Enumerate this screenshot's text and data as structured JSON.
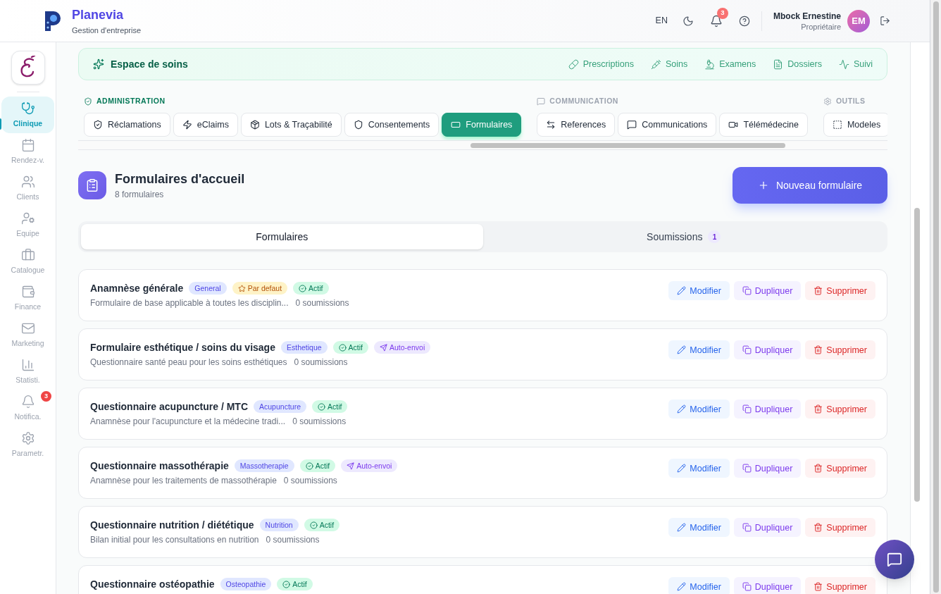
{
  "header": {
    "brand": "Planevia",
    "tagline": "Gestion d'entreprise",
    "language": "EN",
    "notification_count": "3",
    "user": {
      "name": "Mbock Ernestine",
      "role": "Propriétaire",
      "initials": "EM"
    }
  },
  "sidebar": {
    "items": [
      {
        "label": "Clinique",
        "selected": true
      },
      {
        "label": "Rendez-v.",
        "selected": false
      },
      {
        "label": "Clients",
        "selected": false
      },
      {
        "label": "Equipe",
        "selected": false
      },
      {
        "label": "Catalogue",
        "selected": false
      },
      {
        "label": "Finance",
        "selected": false
      },
      {
        "label": "Marketing",
        "selected": false
      },
      {
        "label": "Statisti.",
        "selected": false
      },
      {
        "label": "Notifica.",
        "selected": false,
        "badge": "3"
      },
      {
        "label": "Parametr.",
        "selected": false
      }
    ]
  },
  "care_space": {
    "title": "Espace de soins",
    "links": [
      "Prescriptions",
      "Soins",
      "Examens",
      "Dossiers",
      "Suivi"
    ]
  },
  "tab_groups": [
    {
      "title": "ADMINISTRATION",
      "tabs": [
        {
          "label": "Réclamations",
          "selected": false
        },
        {
          "label": "eClaims",
          "selected": false
        },
        {
          "label": "Lots & Traçabilité",
          "selected": false
        },
        {
          "label": "Consentements",
          "selected": false
        },
        {
          "label": "Formulaires",
          "selected": true
        }
      ]
    },
    {
      "title": "COMMUNICATION",
      "tabs": [
        {
          "label": "References",
          "selected": false
        },
        {
          "label": "Communications",
          "selected": false
        },
        {
          "label": "Télémédecine",
          "selected": false
        }
      ]
    },
    {
      "title": "OUTILS",
      "tabs": [
        {
          "label": "Modeles",
          "selected": false
        }
      ]
    }
  ],
  "page": {
    "title": "Formulaires d'accueil",
    "subtitle": "8 formulaires",
    "new_button": "Nouveau formulaire"
  },
  "view_tabs": [
    {
      "label": "Formulaires",
      "selected": true
    },
    {
      "label": "Soumissions",
      "selected": false,
      "count": "1"
    }
  ],
  "forms": [
    {
      "title": "Anamnèse générale",
      "badges": [
        {
          "kind": "category",
          "label": "General"
        },
        {
          "kind": "default",
          "label": "Par defaut"
        },
        {
          "kind": "active",
          "label": "Actif"
        }
      ],
      "description": "Formulaire de base applicable à toutes les disciplin...",
      "submissions": "0 soumissions",
      "actions": [
        {
          "kind": "edit",
          "label": "Modifier"
        },
        {
          "kind": "duplicate",
          "label": "Dupliquer"
        },
        {
          "kind": "delete",
          "label": "Supprimer"
        }
      ]
    },
    {
      "title": "Formulaire esthétique / soins du visage",
      "badges": [
        {
          "kind": "category",
          "label": "Esthetique"
        },
        {
          "kind": "active",
          "label": "Actif"
        },
        {
          "kind": "auto_send",
          "label": "Auto-envoi"
        }
      ],
      "description": "Questionnaire santé peau pour les soins esthétiques",
      "submissions": "0 soumissions",
      "actions": [
        {
          "kind": "edit",
          "label": "Modifier"
        },
        {
          "kind": "duplicate",
          "label": "Dupliquer"
        },
        {
          "kind": "delete",
          "label": "Supprimer"
        }
      ]
    },
    {
      "title": "Questionnaire acupuncture / MTC",
      "badges": [
        {
          "kind": "category",
          "label": "Acupuncture"
        },
        {
          "kind": "active",
          "label": "Actif"
        }
      ],
      "description": "Anamnèse pour l'acupuncture et la médecine tradi...",
      "submissions": "0 soumissions",
      "actions": [
        {
          "kind": "edit",
          "label": "Modifier"
        },
        {
          "kind": "duplicate",
          "label": "Dupliquer"
        },
        {
          "kind": "delete",
          "label": "Supprimer"
        }
      ]
    },
    {
      "title": "Questionnaire massothérapie",
      "badges": [
        {
          "kind": "category",
          "label": "Massotherapie"
        },
        {
          "kind": "active",
          "label": "Actif"
        },
        {
          "kind": "auto_send",
          "label": "Auto-envoi"
        }
      ],
      "description": "Anamnèse pour les traitements de massothérapie",
      "submissions": "0 soumissions",
      "actions": [
        {
          "kind": "edit",
          "label": "Modifier"
        },
        {
          "kind": "duplicate",
          "label": "Dupliquer"
        },
        {
          "kind": "delete",
          "label": "Supprimer"
        }
      ]
    },
    {
      "title": "Questionnaire nutrition / diététique",
      "badges": [
        {
          "kind": "category",
          "label": "Nutrition"
        },
        {
          "kind": "active",
          "label": "Actif"
        }
      ],
      "description": "Bilan initial pour les consultations en nutrition",
      "submissions": "0 soumissions",
      "actions": [
        {
          "kind": "edit",
          "label": "Modifier"
        },
        {
          "kind": "duplicate",
          "label": "Dupliquer"
        },
        {
          "kind": "delete",
          "label": "Supprimer"
        }
      ]
    },
    {
      "title": "Questionnaire ostéopathie",
      "badges": [
        {
          "kind": "category",
          "label": "Osteopathie"
        },
        {
          "kind": "active",
          "label": "Actif"
        }
      ],
      "actions": [
        {
          "kind": "edit",
          "label": "Modifier"
        },
        {
          "kind": "duplicate",
          "label": "Dupliquer"
        },
        {
          "kind": "delete",
          "label": "Supprimer"
        }
      ]
    }
  ]
}
